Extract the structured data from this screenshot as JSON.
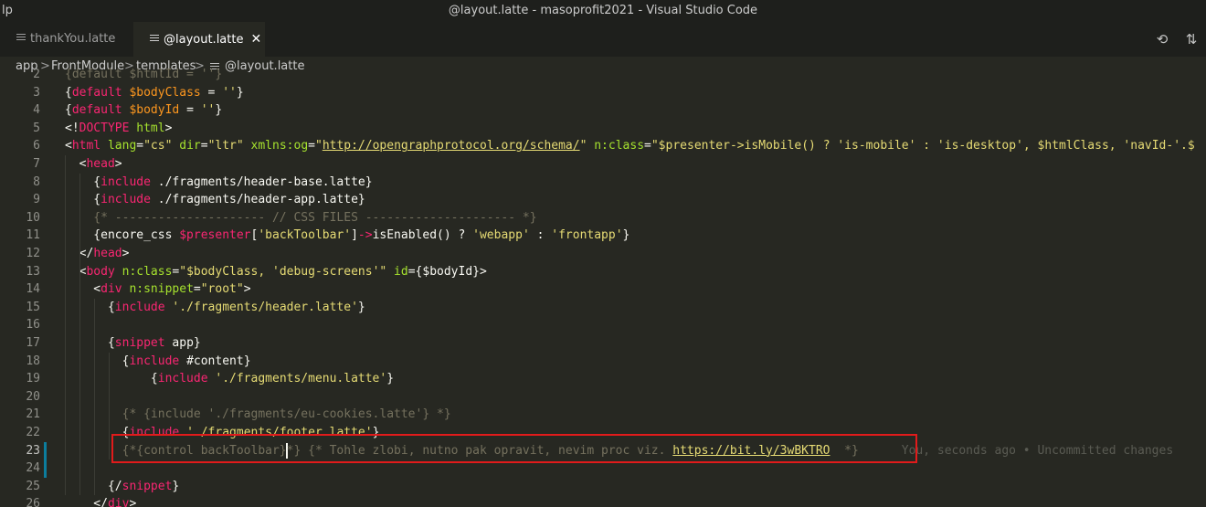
{
  "window": {
    "title": "@layout.latte - masoprofit2021 - Visual Studio Code",
    "left_fragment": "lp"
  },
  "tabs": [
    {
      "label": "thankYou.latte",
      "active": false
    },
    {
      "label": "@layout.latte",
      "active": true,
      "close": "✕"
    }
  ],
  "actions": {
    "history_icon": "⟲",
    "compare_icon": "⇅"
  },
  "breadcrumb": {
    "items": [
      "app",
      "FrontModule",
      "templates",
      "@layout.latte"
    ],
    "sep": ">"
  },
  "editor": {
    "lines": [
      {
        "n": "2",
        "tokens": [
          {
            "t": "{default $htmlId = ''}",
            "c": "c"
          }
        ]
      },
      {
        "n": "3",
        "tokens": [
          {
            "t": "{",
            "c": "b"
          },
          {
            "t": "default ",
            "c": "k"
          },
          {
            "t": "$bodyClass",
            "c": "v"
          },
          {
            "t": " = ",
            "c": "b"
          },
          {
            "t": "''",
            "c": "s"
          },
          {
            "t": "}",
            "c": "b"
          }
        ]
      },
      {
        "n": "4",
        "tokens": [
          {
            "t": "{",
            "c": "b"
          },
          {
            "t": "default ",
            "c": "k"
          },
          {
            "t": "$bodyId",
            "c": "v"
          },
          {
            "t": " = ",
            "c": "b"
          },
          {
            "t": "''",
            "c": "s"
          },
          {
            "t": "}",
            "c": "b"
          }
        ]
      },
      {
        "n": "5",
        "tokens": [
          {
            "t": "<!",
            "c": "b"
          },
          {
            "t": "DOCTYPE",
            "c": "k"
          },
          {
            "t": " html",
            "c": "a"
          },
          {
            "t": ">",
            "c": "b"
          }
        ]
      },
      {
        "n": "6",
        "tokens": [
          {
            "t": "<",
            "c": "b"
          },
          {
            "t": "html",
            "c": "k"
          },
          {
            "t": " lang",
            "c": "a"
          },
          {
            "t": "=",
            "c": "b"
          },
          {
            "t": "\"cs\"",
            "c": "s"
          },
          {
            "t": " dir",
            "c": "a"
          },
          {
            "t": "=",
            "c": "b"
          },
          {
            "t": "\"ltr\"",
            "c": "s"
          },
          {
            "t": " xmlns:og",
            "c": "a"
          },
          {
            "t": "=",
            "c": "b"
          },
          {
            "t": "\"",
            "c": "s"
          },
          {
            "t": "http://opengraphprotocol.org/schema/",
            "c": "u"
          },
          {
            "t": "\"",
            "c": "s"
          },
          {
            "t": " n:class",
            "c": "a"
          },
          {
            "t": "=",
            "c": "b"
          },
          {
            "t": "\"$presenter->isMobile() ? 'is-mobile' : 'is-desktop', $htmlClass, 'navId-'.$",
            "c": "s"
          }
        ]
      },
      {
        "n": "7",
        "tokens": [
          {
            "t": "  ",
            "c": "b"
          },
          {
            "t": "<",
            "c": "b"
          },
          {
            "t": "head",
            "c": "k"
          },
          {
            "t": ">",
            "c": "b"
          }
        ]
      },
      {
        "n": "8",
        "tokens": [
          {
            "t": "    {",
            "c": "b"
          },
          {
            "t": "include",
            "c": "k"
          },
          {
            "t": " ./fragments/header-base.latte}",
            "c": "b"
          }
        ]
      },
      {
        "n": "9",
        "tokens": [
          {
            "t": "    {",
            "c": "b"
          },
          {
            "t": "include",
            "c": "k"
          },
          {
            "t": " ./fragments/header-app.latte}",
            "c": "b"
          }
        ]
      },
      {
        "n": "10",
        "tokens": [
          {
            "t": "    {* --------------------- // CSS FILES --------------------- *}",
            "c": "c"
          }
        ]
      },
      {
        "n": "11",
        "tokens": [
          {
            "t": "    {encore_css ",
            "c": "b"
          },
          {
            "t": "$presenter",
            "c": "k"
          },
          {
            "t": "[",
            "c": "b"
          },
          {
            "t": "'backToolbar'",
            "c": "s"
          },
          {
            "t": "]",
            "c": "b"
          },
          {
            "t": "->",
            "c": "k"
          },
          {
            "t": "isEnabled() ? ",
            "c": "b"
          },
          {
            "t": "'webapp'",
            "c": "s"
          },
          {
            "t": " : ",
            "c": "b"
          },
          {
            "t": "'frontapp'",
            "c": "s"
          },
          {
            "t": "}",
            "c": "b"
          }
        ]
      },
      {
        "n": "12",
        "tokens": [
          {
            "t": "  </",
            "c": "b"
          },
          {
            "t": "head",
            "c": "k"
          },
          {
            "t": ">",
            "c": "b"
          }
        ]
      },
      {
        "n": "13",
        "tokens": [
          {
            "t": "  <",
            "c": "b"
          },
          {
            "t": "body",
            "c": "k"
          },
          {
            "t": " n:class",
            "c": "a"
          },
          {
            "t": "=",
            "c": "b"
          },
          {
            "t": "\"$bodyClass, 'debug-screens'\"",
            "c": "s"
          },
          {
            "t": " id",
            "c": "a"
          },
          {
            "t": "=",
            "c": "b"
          },
          {
            "t": "{$bodyId}",
            "c": "b"
          },
          {
            "t": ">",
            "c": "b"
          }
        ]
      },
      {
        "n": "14",
        "tokens": [
          {
            "t": "    <",
            "c": "b"
          },
          {
            "t": "div",
            "c": "k"
          },
          {
            "t": " n:snippet",
            "c": "a"
          },
          {
            "t": "=",
            "c": "b"
          },
          {
            "t": "\"root\"",
            "c": "s"
          },
          {
            "t": ">",
            "c": "b"
          }
        ]
      },
      {
        "n": "15",
        "tokens": [
          {
            "t": "      {",
            "c": "b"
          },
          {
            "t": "include",
            "c": "k"
          },
          {
            "t": " ",
            "c": "b"
          },
          {
            "t": "'./fragments/header.latte'",
            "c": "s"
          },
          {
            "t": "}",
            "c": "b"
          }
        ]
      },
      {
        "n": "16",
        "tokens": []
      },
      {
        "n": "17",
        "tokens": [
          {
            "t": "      {",
            "c": "b"
          },
          {
            "t": "snippet",
            "c": "k"
          },
          {
            "t": " app}",
            "c": "b"
          }
        ]
      },
      {
        "n": "18",
        "tokens": [
          {
            "t": "        {",
            "c": "b"
          },
          {
            "t": "include",
            "c": "k"
          },
          {
            "t": " #content}",
            "c": "b"
          }
        ]
      },
      {
        "n": "19",
        "tokens": [
          {
            "t": "            {",
            "c": "b"
          },
          {
            "t": "include",
            "c": "k"
          },
          {
            "t": " ",
            "c": "b"
          },
          {
            "t": "'./fragments/menu.latte'",
            "c": "s"
          },
          {
            "t": "}",
            "c": "b"
          }
        ]
      },
      {
        "n": "20",
        "tokens": []
      },
      {
        "n": "21",
        "tokens": [
          {
            "t": "        {* {include './fragments/eu-cookies.latte'} *}",
            "c": "c"
          }
        ]
      },
      {
        "n": "22",
        "tokens": [
          {
            "t": "        {",
            "c": "b"
          },
          {
            "t": "include",
            "c": "k"
          },
          {
            "t": " ",
            "c": "b"
          },
          {
            "t": "'./fragments/footer.latte'",
            "c": "s"
          },
          {
            "t": "}",
            "c": "b"
          }
        ]
      },
      {
        "n": "23",
        "tokens": [
          {
            "t": "        {*{control backToolbar}",
            "c": "c"
          },
          {
            "t": "|cursor|",
            "c": "cursor"
          },
          {
            "t": "*} {* Tohle zlobi, nutno pak opravit, nevim proc viz. ",
            "c": "c"
          },
          {
            "t": "https://bit.ly/3wBKTRO",
            "c": "cu"
          },
          {
            "t": "  *}",
            "c": "c"
          }
        ],
        "active": true
      },
      {
        "n": "24",
        "tokens": []
      },
      {
        "n": "25",
        "tokens": [
          {
            "t": "      {/",
            "c": "b"
          },
          {
            "t": "snippet",
            "c": "k"
          },
          {
            "t": "}",
            "c": "b"
          }
        ]
      },
      {
        "n": "26",
        "tokens": [
          {
            "t": "    </",
            "c": "b"
          },
          {
            "t": "div",
            "c": "k"
          },
          {
            "t": ">",
            "c": "b"
          }
        ]
      }
    ],
    "blame": "You, seconds ago • Uncommitted changes"
  },
  "colors": {
    "background": "#272822",
    "highlight_box": "#e11b1b",
    "modified_gutter": "#0c7d9d"
  }
}
